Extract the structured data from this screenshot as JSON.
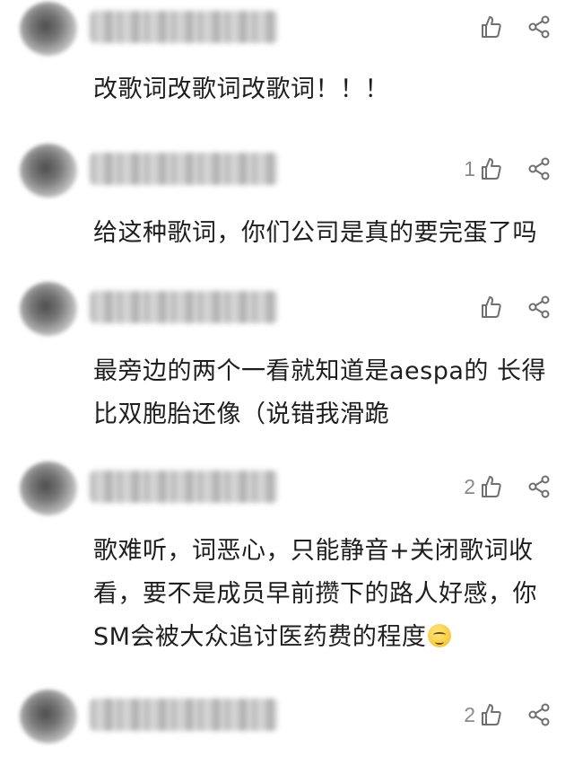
{
  "comments": [
    {
      "username": "blurred-user-1",
      "likes": "",
      "text": "改歌词改歌词改歌词！！！"
    },
    {
      "username": "blurred-user-2",
      "likes": "1",
      "text": "给这种歌词，你们公司是真的要完蛋了吗"
    },
    {
      "username": "blurred-user-3",
      "likes": "",
      "text_line1": "最旁边的两个一看就知道是aespa的 长得",
      "text_line2": "比双胞胎还像（说错我滑跪"
    },
    {
      "username": "blurred-user-4",
      "likes": "2",
      "text_line1": "歌难听，词恶心，只能静音+关闭歌词收",
      "text_line2": "看，要不是成员早前攒下的路人好感，你",
      "text_line3": "SM会被大众追讨医药费的程度"
    },
    {
      "username": "blurred-user-5",
      "likes": "2",
      "text": ""
    }
  ],
  "icons": {
    "like": "thumbs-up-icon",
    "share": "share-icon",
    "emoji": "awkward-smile-emoji-icon"
  },
  "colors": {
    "text": "#1e1e1e",
    "icon": "#6f6f6f",
    "count": "#8a8a8a",
    "emoji": "#f2bd27"
  }
}
